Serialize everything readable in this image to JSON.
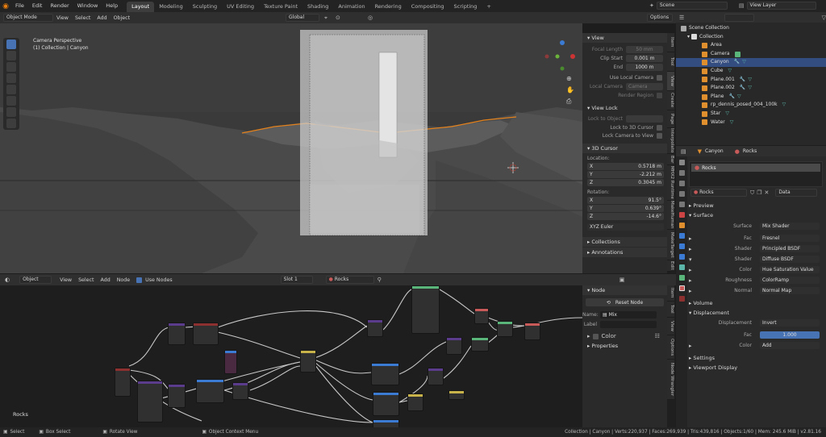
{
  "topbar": {
    "menus": [
      "File",
      "Edit",
      "Render",
      "Window",
      "Help"
    ],
    "workspaces": [
      "Layout",
      "Modeling",
      "Sculpting",
      "UV Editing",
      "Texture Paint",
      "Shading",
      "Animation",
      "Rendering",
      "Compositing",
      "Scripting"
    ],
    "active_workspace": "Layout",
    "plus": "+",
    "scene": "Scene",
    "view_layer": "View Layer"
  },
  "viewport": {
    "mode": "Object Mode",
    "menus": [
      "View",
      "Select",
      "Add",
      "Object"
    ],
    "orientation": "Global",
    "options": "Options",
    "overlay_line1": "Camera Perspective",
    "overlay_line2": "(1) Collection | Canyon"
  },
  "view_panel": {
    "title": "View",
    "focal_label": "Focal Length",
    "focal": "50 mm",
    "clip_start_label": "Clip Start",
    "clip_start": "0.001 m",
    "end_label": "End",
    "end": "1000 m",
    "local_camera_chk": "Use Local Camera",
    "local_camera_label": "Local Camera",
    "local_camera": "Camera",
    "render_region": "Render Region",
    "view_lock": "View Lock",
    "lock_object": "Lock to Object",
    "lock_cursor": "Lock to 3D Cursor",
    "lock_camera": "Lock Camera to View",
    "cursor_title": "3D Cursor",
    "location": "Location:",
    "x": "0.5718 m",
    "y": "-2.212 m",
    "z": "0.3045 m",
    "rotation": "Rotation:",
    "rx": "91.5°",
    "ry": "0.639°",
    "rz": "-14.6°",
    "rot_mode": "XYZ Euler",
    "collections": "Collections",
    "annotations": "Annotations",
    "x_l": "X",
    "y_l": "Y",
    "z_l": "Z"
  },
  "viewport_tabs": [
    "Item",
    "Tool",
    "View",
    "Create",
    "Page",
    "Interpolato",
    "Bar",
    "MHX2 Runtime",
    "MakeHuman",
    "MakeTarget",
    "Edit"
  ],
  "outliner": {
    "root": "Scene Collection",
    "collection": "Collection",
    "items": [
      "Area",
      "Camera",
      "Canyon",
      "Cube",
      "Plane.001",
      "Plane.002",
      "Plane",
      "rp_dennis_posed_004_100k",
      "Star",
      "Water"
    ],
    "selected": "Canyon"
  },
  "properties": {
    "object": "Canyon",
    "material": "Rocks",
    "slot": "Rocks",
    "mat_name": "Rocks",
    "data": "Data",
    "preview": "Preview",
    "surface_sec": "Surface",
    "surface_label": "Surface",
    "surface": "Mix Shader",
    "fac_label": "Fac",
    "fac": "Fresnel",
    "shader1_label": "Shader",
    "shader1": "Principled BSDF",
    "shader2_label": "Shader",
    "shader2": "Diffuse BSDF",
    "color_label": "Color",
    "color": "Hue Saturation Value",
    "roughness_label": "Roughness",
    "roughness": "ColorRamp",
    "normal_label": "Normal",
    "normal": "Normal Map",
    "volume": "Volume",
    "displacement_sec": "Displacement",
    "displacement_label": "Displacement",
    "displacement": "Invert",
    "dfac_label": "Fac",
    "dfac": "1.000",
    "dcolor_label": "Color",
    "dcolor": "Add",
    "settings": "Settings",
    "viewport_display": "Viewport Display"
  },
  "node_editor": {
    "mode": "Object",
    "menus": [
      "View",
      "Select",
      "Add",
      "Node"
    ],
    "use_nodes": "Use Nodes",
    "slot": "Slot 1",
    "material": "Rocks",
    "frame_label": "Rocks",
    "panel_title": "Node",
    "reset": "Reset Node",
    "name_label": "Name:",
    "name": "Mix",
    "label_label": "Label",
    "color": "Color",
    "properties": "Properties"
  },
  "node_tabs": [
    "Item",
    "Tool",
    "View",
    "Options",
    "Node Wrangler"
  ],
  "statusbar": {
    "select": "Select",
    "box_select": "Box Select",
    "rotate": "Rotate View",
    "context": "Object Context Menu",
    "stats": "Collection | Canyon | Verts:220,937 | Faces:269,939 | Tris:439,816 | Objects:1/60 | Mem: 245.6 MiB | v2.81.16"
  },
  "colors": {
    "accent": "#4772b3",
    "selected_row": "#334d80",
    "header_orange": "#e3811c",
    "active_tab": "#3d3d3d"
  }
}
